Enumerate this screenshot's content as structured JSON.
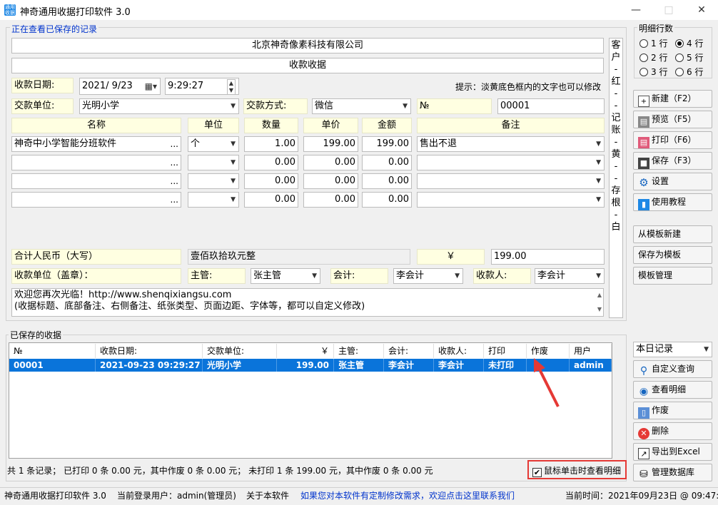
{
  "window": {
    "title": "神奇通用收据打印软件 3.0",
    "icon_text": "通用收据"
  },
  "header": {
    "viewing": "正在查看已保存的记录"
  },
  "receipt": {
    "company": "北京神奇像素科技有限公司",
    "title": "收款收据",
    "date_label": "收款日期:",
    "date": "2021/ 9/23",
    "time": "9:29:27",
    "hint": "提示：淡黄底色框内的文字也可以修改",
    "payer_label": "交款单位:",
    "payer": "光明小学",
    "method_label": "交款方式:",
    "method": "微信",
    "no_label": "№",
    "no": "00001",
    "cols": {
      "name": "名称",
      "unit": "单位",
      "qty": "数量",
      "price": "单价",
      "amount": "金额",
      "note": "备注"
    },
    "items": [
      {
        "name": "神奇中小学智能分班软件",
        "unit": "个",
        "qty": "1.00",
        "price": "199.00",
        "amount": "199.00",
        "note": "售出不退"
      },
      {
        "name": "",
        "unit": "",
        "qty": "0.00",
        "price": "0.00",
        "amount": "0.00",
        "note": ""
      },
      {
        "name": "",
        "unit": "",
        "qty": "0.00",
        "price": "0.00",
        "amount": "0.00",
        "note": ""
      },
      {
        "name": "",
        "unit": "",
        "qty": "0.00",
        "price": "0.00",
        "amount": "0.00",
        "note": ""
      }
    ],
    "total_label": "合计人民币（大写）",
    "total_text": "壹佰玖拾玖元整",
    "yen": "￥",
    "total": "199.00",
    "seal_label": "收款单位（盖章）：",
    "manager_label": "主管:",
    "manager": "张主管",
    "accountant_label": "会计:",
    "accountant": "李会计",
    "cashier_label": "收款人:",
    "cashier": "李会计",
    "footer_line1": "欢迎您再次光临！http://www.shenqixiangsu.com",
    "footer_line2": "(收据标题、底部备注、右侧备注、纸张类型、页面边距、字体等，都可以自定义修改)",
    "side_note": [
      "客",
      "户",
      "-",
      "红",
      "-",
      "-",
      "记",
      "账",
      "-",
      "黄",
      "-",
      "-",
      "存",
      "根",
      "-",
      "白"
    ]
  },
  "rows_group": {
    "title": "明细行数",
    "options": [
      "1 行",
      "4 行",
      "2 行",
      "5 行",
      "3 行",
      "6 行"
    ],
    "selected": "4 行"
  },
  "buttons": {
    "new": "新建（F2）",
    "preview": "预览（F5）",
    "print": "打印（F6）",
    "save": "保存（F3）",
    "settings": "设置",
    "tutorial": "使用教程",
    "from_template": "从模板新建",
    "save_template": "保存为模板",
    "manage_template": "模板管理"
  },
  "saved": {
    "title": "已保存的收据",
    "headers": [
      "№",
      "收款日期:",
      "交款单位:",
      "￥",
      "主管:",
      "会计:",
      "收款人:",
      "打印",
      "作废",
      "用户"
    ],
    "rows": [
      [
        "00001",
        "2021-09-23 09:29:27",
        "光明小学",
        "199.00",
        "张主管",
        "李会计",
        "李会计",
        "未打印",
        "",
        "admin"
      ]
    ],
    "summary": "共 1 条记录；   已打印 0 条 0.00 元，其中作废 0 条 0.00 元；   未打印 1 条 199.00 元，其中作废 0 条 0.00 元",
    "click_view_label": "鼠标单击时查看明细",
    "click_view_checked": true
  },
  "filter": {
    "selected": "本日记录"
  },
  "side_buttons": {
    "custom_query": "自定义查询",
    "view_detail": "查看明细",
    "void": "作废",
    "delete": "删除",
    "export": "导出到Excel",
    "db": "管理数据库"
  },
  "statusbar": {
    "app": "神奇通用收据打印软件 3.0",
    "user": "当前登录用户：admin(管理员)",
    "about": "关于本软件",
    "custom": "如果您对本软件有定制修改需求，欢迎点击这里联系我们",
    "time": "当前时间：2021年09月23日 @ 09:47:28"
  }
}
